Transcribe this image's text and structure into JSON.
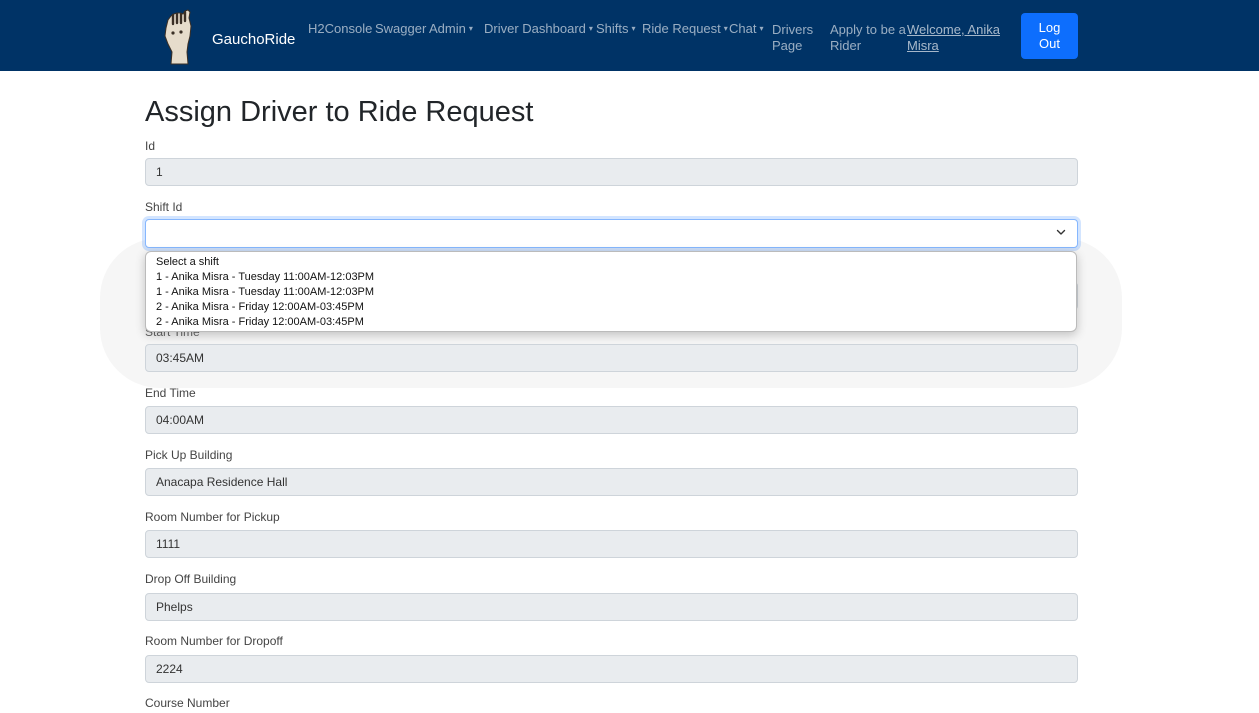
{
  "navbar": {
    "brand": "GauchoRide",
    "items": [
      {
        "label": "H2Console",
        "caret": ""
      },
      {
        "label": "Swagger",
        "caret": ""
      },
      {
        "label": "Admin",
        "caret": "▾"
      },
      {
        "label": "Driver Dashboard",
        "caret": "▾"
      },
      {
        "label": "Shifts",
        "caret": "▾"
      },
      {
        "label": "Ride Request",
        "caret": "▾"
      },
      {
        "label": "Chat",
        "caret": "▾"
      }
    ],
    "drivers_page": {
      "line1": "Drivers",
      "line2": "Page"
    },
    "apply": {
      "line1": "Apply to be a",
      "line2": "Rider"
    },
    "welcome": {
      "line1": "Welcome, Anika",
      "line2": "Misra"
    },
    "logout": {
      "line1": "Log",
      "line2": "Out"
    },
    "colors": {
      "background": "#003366",
      "logout_button": "#0d6efd"
    }
  },
  "page": {
    "title": "Assign Driver to Ride Request"
  },
  "form": {
    "id": {
      "label": "Id",
      "value": "1"
    },
    "shift": {
      "label": "Shift Id",
      "value": "",
      "options": [
        "Select a shift",
        "1 - Anika Misra - Tuesday 11:00AM-12:03PM",
        "1 - Anika Misra - Tuesday 11:00AM-12:03PM",
        "2 - Anika Misra - Friday 12:00AM-03:45PM",
        "2 - Anika Misra - Friday 12:00AM-03:45PM"
      ]
    },
    "start_time": {
      "value": "03:45AM"
    },
    "end_time": {
      "label": "End Time",
      "value": "04:00AM"
    },
    "pickup_building": {
      "label": "Pick Up Building",
      "value": "Anacapa Residence Hall"
    },
    "pickup_room": {
      "label": "Room Number for Pickup",
      "value": "1111"
    },
    "dropoff_building": {
      "label": "Drop Off Building",
      "value": "Phelps"
    },
    "dropoff_room": {
      "label": "Room Number for Dropoff",
      "value": "2224"
    },
    "course_number": {
      "label": "Course Number"
    }
  }
}
